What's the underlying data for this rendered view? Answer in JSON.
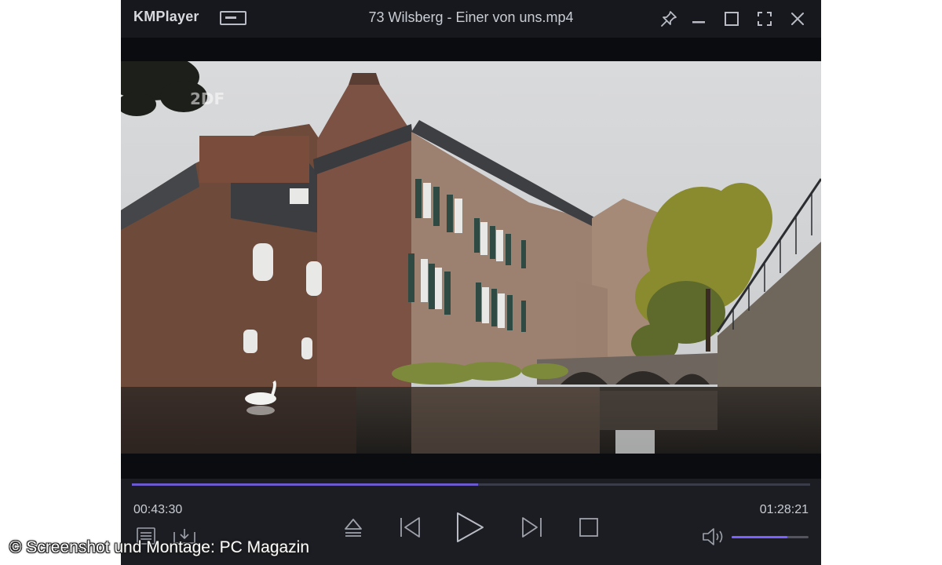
{
  "app": {
    "logo_text": "KMPlayer",
    "window_title": "73 Wilsberg - Einer von uns.mp4"
  },
  "titlebar_icons": [
    "mini-mode-icon",
    "pin-icon",
    "minimize-icon",
    "maximize-icon",
    "fullscreen-icon",
    "close-icon"
  ],
  "video": {
    "channel_logo": "2DF",
    "scene": "castle-with-moat"
  },
  "playback": {
    "elapsed": "00:43:30",
    "duration": "01:28:21",
    "progress_fraction": 0.51,
    "volume_fraction": 0.72
  },
  "controls_icons": [
    "playlist-icon",
    "download-icon",
    "eject-icon",
    "previous-icon",
    "play-icon",
    "next-icon",
    "stop-icon",
    "volume-icon"
  ],
  "colors": {
    "accent": "#6a5acd",
    "volume_accent": "#7b61ff",
    "panel": "#16181e"
  },
  "credit": "© Screenshot und Montage: PC Magazin"
}
